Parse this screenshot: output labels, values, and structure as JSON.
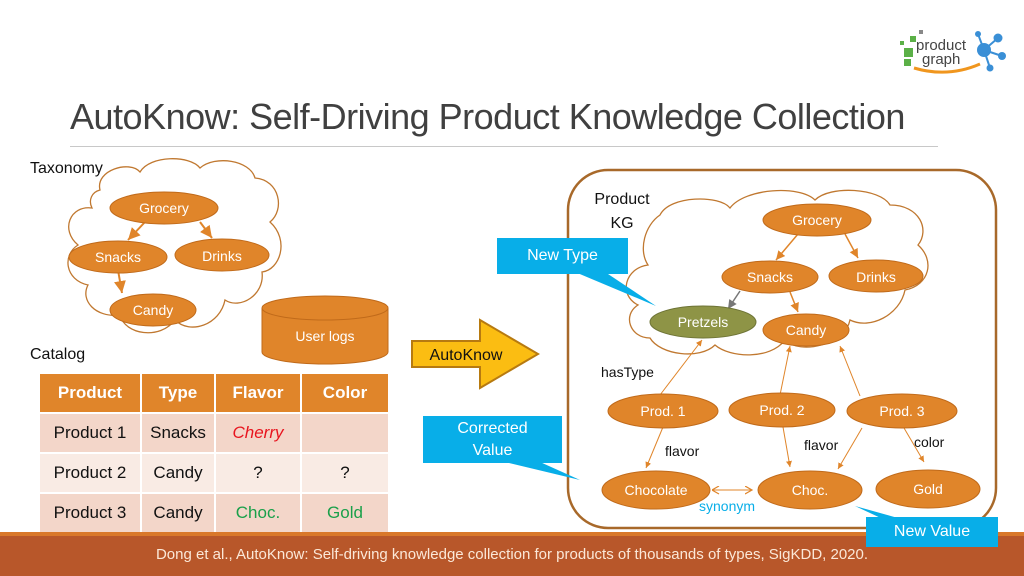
{
  "slide": {
    "title": "AutoKnow: Self-Driving Product Knowledge Collection",
    "footer": "Dong et al., AutoKnow: Self-driving knowledge collection for products of thousands of types, SigKDD, 2020.",
    "logo": {
      "line1": "product",
      "line2": "graph",
      "icon": "network-graph-icon"
    }
  },
  "taxonomy": {
    "label": "Taxonomy",
    "nodes": [
      "Grocery",
      "Snacks",
      "Drinks",
      "Candy"
    ]
  },
  "user_logs": {
    "label": "User logs"
  },
  "catalog": {
    "label": "Catalog",
    "columns": [
      "Product",
      "Type",
      "Flavor",
      "Color"
    ],
    "rows": [
      {
        "product": "Product 1",
        "type": "Snacks",
        "flavor": "Cherry",
        "color": ""
      },
      {
        "product": "Product 2",
        "type": "Candy",
        "flavor": "?",
        "color": "?"
      },
      {
        "product": "Product 3",
        "type": "Candy",
        "flavor": "Choc.",
        "color": "Gold"
      }
    ],
    "colors": {
      "error": "#e8141e",
      "correct": "#1aa04a"
    }
  },
  "arrow": {
    "label": "AutoKnow"
  },
  "kg": {
    "label_line1": "Product",
    "label_line2": "KG",
    "type_nodes": [
      "Grocery",
      "Snacks",
      "Drinks",
      "Pretzels",
      "Candy"
    ],
    "product_nodes": [
      "Prod. 1",
      "Prod. 2",
      "Prod. 3"
    ],
    "value_nodes": [
      "Chocolate",
      "Choc.",
      "Gold"
    ],
    "edge_labels": {
      "hasType": "hasType",
      "flavor1": "flavor",
      "flavor2": "flavor",
      "color": "color",
      "synonym": "synonym"
    }
  },
  "callouts": {
    "new_type": "New Type",
    "corrected_line1": "Corrected",
    "corrected_line2": "Value",
    "new_value": "New Value"
  },
  "colors": {
    "node": "#e0852a",
    "new_node": "#8e9446",
    "callout": "#08aee8",
    "footer": "#b8572a"
  }
}
